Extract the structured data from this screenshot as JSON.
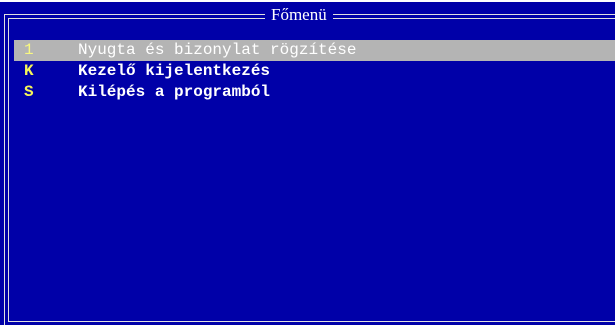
{
  "menu": {
    "title": "Főmenü",
    "items": [
      {
        "hotkey": "1",
        "label": "Nyugta és bizonylat rögzítése",
        "selected": true
      },
      {
        "hotkey": "K",
        "label": "Kezelő kijelentkezés",
        "selected": false
      },
      {
        "hotkey": "S",
        "label": "Kilépés a programból",
        "selected": false
      }
    ]
  },
  "colors": {
    "background": "#0000a8",
    "frame": "#e0e0e0",
    "text": "#ffffff",
    "hotkey": "#f4f45a",
    "selection": "#b4b4b4"
  }
}
